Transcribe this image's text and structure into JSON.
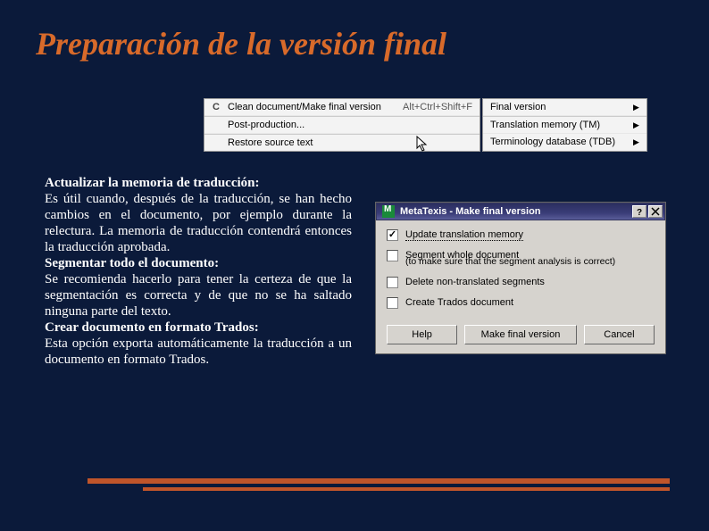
{
  "title": "Preparación de la versión final",
  "menu_left": {
    "icon_letter": "C",
    "items": [
      {
        "label": "Clean document/Make final version",
        "shortcut": "Alt+Ctrl+Shift+F"
      },
      {
        "label": "Post-production..."
      },
      {
        "label": "Restore source text"
      }
    ]
  },
  "menu_right": {
    "items": [
      {
        "label": "Final version"
      },
      {
        "label": "Translation memory (TM)"
      },
      {
        "label": "Terminology database (TDB)"
      }
    ]
  },
  "body": {
    "p1_bold": "Actualizar la memoria de traducción:",
    "p1": "Es útil cuando, después de la traducción, se han hecho cambios en el documento, por ejemplo durante la relectura. La memoria de traducción contendrá entonces la traducción aprobada.",
    "p2_bold": "Segmentar todo el documento:",
    "p2": "Se recomienda hacerlo para tener la certeza de que la segmentación es correcta y de que no se ha saltado ninguna parte del texto.",
    "p3_bold": "Crear documento en formato Trados:",
    "p3": "Esta opción exporta automáticamente la traducción a un documento en formato Trados."
  },
  "dialog": {
    "title": "MetaTexis - Make final version",
    "chk1": "Update translation memory",
    "chk2": "Segment whole document",
    "chk2_sub": "(to make sure that the segment analysis is correct)",
    "chk3": "Delete non-translated segments",
    "chk4": "Create Trados document",
    "btn_help": "Help",
    "btn_ok": "Make final version",
    "btn_cancel": "Cancel"
  }
}
